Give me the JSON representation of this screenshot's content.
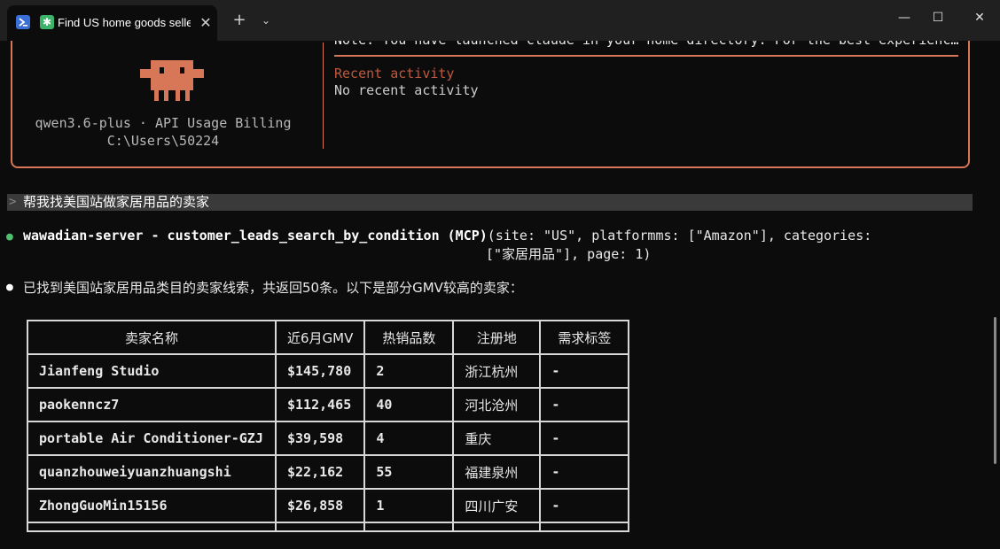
{
  "tab": {
    "title": "Find US home goods seller",
    "close_glyph": "✕",
    "icon": "powershell-icon",
    "status_icon": "claude-spinner-icon"
  },
  "titlebar": {
    "new_tab_glyph": "+",
    "dropdown_glyph": "⌄",
    "minimize_glyph": "—",
    "maximize_glyph": "☐",
    "close_glyph": "✕"
  },
  "welcome": {
    "model_line": "qwen3.6-plus · API Usage Billing",
    "path_line": "C:\\Users\\50224",
    "note": "Note: You have launched claude in your home directory. For the best experienc…",
    "recent_title": "Recent activity",
    "recent_body": "No recent activity",
    "accent_color": "#d77757"
  },
  "prompt": {
    "caret": ">",
    "text": "帮我找美国站做家居用品的卖家"
  },
  "tool_call": {
    "server": "wawadian-server - customer_leads_search_by_condition (MCP)",
    "args_line1": "(site: \"US\", platformms: [\"Amazon\"], categories:",
    "args_line2": "[\"家居用品\"], page: 1)",
    "bullet": "●",
    "bullet_color": "#4ec16e"
  },
  "message": {
    "bullet": "●",
    "text": "已找到美国站家居用品类目的卖家线索，共返回50条。以下是部分GMV较高的卖家："
  },
  "table": {
    "headers": [
      "卖家名称",
      "近6月GMV",
      "热销品数",
      "注册地",
      "需求标签"
    ],
    "rows": [
      [
        "Jianfeng Studio",
        "$145,780",
        "2",
        "浙江杭州",
        "-"
      ],
      [
        "paokenncz7",
        "$112,465",
        "40",
        "河北沧州",
        "-"
      ],
      [
        "portable Air Conditioner-GZJ",
        "$39,598",
        "4",
        "重庆",
        "-"
      ],
      [
        "quanzhouweiyuanzhuangshi",
        "$22,162",
        "55",
        "福建泉州",
        "-"
      ],
      [
        "ZhongGuoMin15156",
        "$26,858",
        "1",
        "四川广安",
        "-"
      ]
    ]
  }
}
